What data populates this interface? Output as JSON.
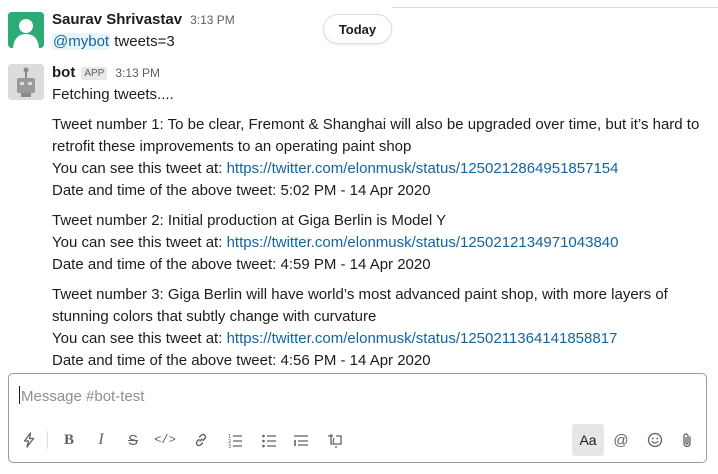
{
  "day_divider": {
    "label": "Today"
  },
  "messages": [
    {
      "sender": "Saurav Shrivastav",
      "time": "3:13 PM",
      "mention": "@mybot",
      "text": " tweets=3"
    },
    {
      "sender": "bot",
      "badge": "APP",
      "time": "3:13 PM",
      "intro": "Fetching tweets....",
      "tweets": [
        {
          "line1": "Tweet number 1: To be clear, Fremont & Shanghai will also be upgraded over time, but it’s hard to",
          "line2": "retrofit these improvements to an operating paint shop",
          "see_prefix": "You can see this tweet at: ",
          "url": "https://twitter.com/elonmusk/status/1250212864951857154",
          "date_line": "Date and time of the above tweet: 5:02 PM - 14 Apr 2020"
        },
        {
          "line1": "Tweet number 2: Initial production at Giga Berlin is Model Y",
          "see_prefix": "You can see this tweet at: ",
          "url": "https://twitter.com/elonmusk/status/1250212134971043840",
          "date_line": "Date and time of the above tweet: 4:59 PM - 14 Apr 2020"
        },
        {
          "line1": "Tweet number 3: Giga Berlin will have world’s most advanced paint shop, with more layers of",
          "line2": "stunning colors that subtly change with curvature",
          "see_prefix": "You can see this tweet at: ",
          "url": "https://twitter.com/elonmusk/status/1250211364141858817",
          "date_line": "Date and time of the above tweet: 4:56 PM - 14 Apr 2020"
        }
      ]
    }
  ],
  "composer": {
    "placeholder": "Message #bot-test",
    "format_button_label": "Aa"
  },
  "icons": [
    "lightning-icon",
    "bold-icon",
    "italic-icon",
    "strikethrough-icon",
    "code-icon",
    "link-icon",
    "ordered-list-icon",
    "bulleted-list-icon",
    "blockquote-icon",
    "code-block-icon",
    "mention-icon",
    "emoji-icon",
    "attach-icon"
  ],
  "colors": {
    "link": "#1264a3",
    "mention_bg": "#e8f5fa",
    "user_avatar": "#2bac76"
  }
}
